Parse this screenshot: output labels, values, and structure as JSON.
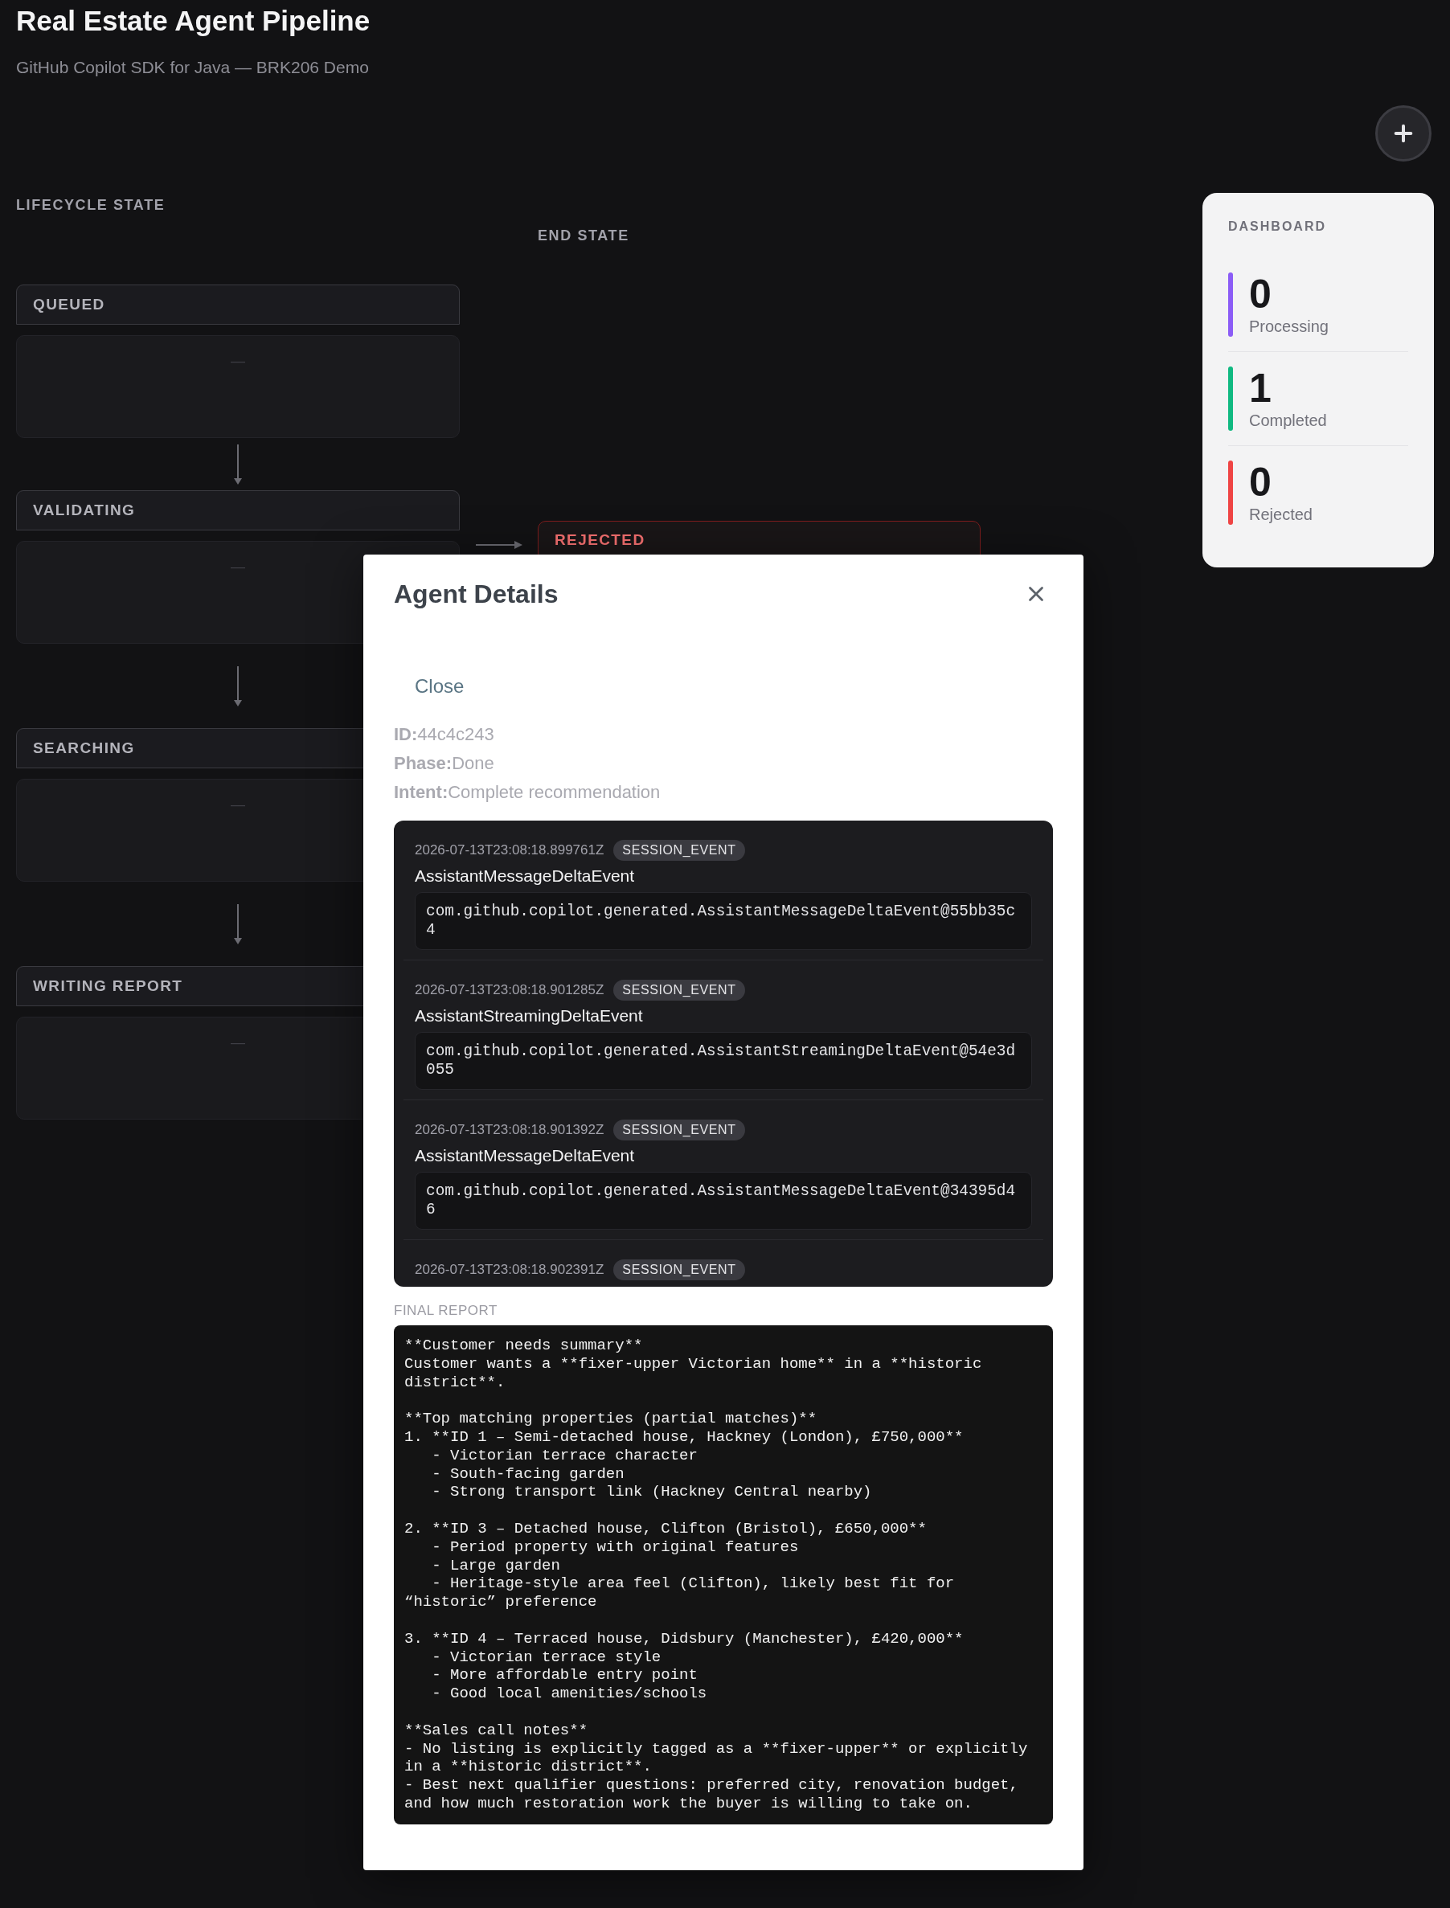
{
  "header": {
    "title": "Real Estate Agent Pipeline",
    "subtitle": "GitHub Copilot SDK for Java — BRK206 Demo"
  },
  "lifecycle": {
    "heading": "LIFECYCLE STATE",
    "stages": [
      {
        "label": "QUEUED",
        "empty_text": "—"
      },
      {
        "label": "VALIDATING",
        "empty_text": "—"
      },
      {
        "label": "SEARCHING",
        "empty_text": "—"
      },
      {
        "label": "WRITING REPORT",
        "empty_text": "—"
      }
    ]
  },
  "end_state": {
    "heading": "END STATE",
    "cards": [
      {
        "label": "REJECTED",
        "kind": "rejected"
      }
    ]
  },
  "dashboard": {
    "heading": "DASHBOARD",
    "stats": [
      {
        "value": "0",
        "label": "Processing",
        "color": "#8b5cf6"
      },
      {
        "value": "1",
        "label": "Completed",
        "color": "#10b981"
      },
      {
        "value": "0",
        "label": "Rejected",
        "color": "#ef4444"
      }
    ]
  },
  "modal": {
    "title": "Agent Details",
    "close_label": "Close",
    "fields": [
      {
        "label": "ID:",
        "value": "44c4c243"
      },
      {
        "label": "Phase:",
        "value": "Done"
      },
      {
        "label": "Intent:",
        "value": "Complete recommendation"
      }
    ],
    "events": [
      {
        "timestamp": "2026-07-13T23:08:18.899761Z",
        "badge": "SESSION_EVENT",
        "name": "AssistantMessageDeltaEvent",
        "payload": "com.github.copilot.generated.AssistantMessageDeltaEvent@55bb35c4"
      },
      {
        "timestamp": "2026-07-13T23:08:18.901285Z",
        "badge": "SESSION_EVENT",
        "name": "AssistantStreamingDeltaEvent",
        "payload": "com.github.copilot.generated.AssistantStreamingDeltaEvent@54e3d055"
      },
      {
        "timestamp": "2026-07-13T23:08:18.901392Z",
        "badge": "SESSION_EVENT",
        "name": "AssistantMessageDeltaEvent",
        "payload": "com.github.copilot.generated.AssistantMessageDeltaEvent@34395d46"
      },
      {
        "timestamp": "2026-07-13T23:08:18.902391Z",
        "badge": "SESSION_EVENT"
      }
    ],
    "report_label": "FINAL REPORT",
    "report": "**Customer needs summary**\nCustomer wants a **fixer-upper Victorian home** in a **historic district**.\n\n**Top matching properties (partial matches)**\n1. **ID 1 – Semi-detached house, Hackney (London), £750,000**\n   - Victorian terrace character\n   - South-facing garden\n   - Strong transport link (Hackney Central nearby)\n\n2. **ID 3 – Detached house, Clifton (Bristol), £650,000**\n   - Period property with original features\n   - Large garden\n   - Heritage-style area feel (Clifton), likely best fit for “historic” preference\n\n3. **ID 4 – Terraced house, Didsbury (Manchester), £420,000**\n   - Victorian terrace style\n   - More affordable entry point\n   - Good local amenities/schools\n\n**Sales call notes**\n- No listing is explicitly tagged as a **fixer-upper** or explicitly in a **historic district**.\n- Best next qualifier questions: preferred city, renovation budget, and how much restoration work the buyer is willing to take on."
  }
}
